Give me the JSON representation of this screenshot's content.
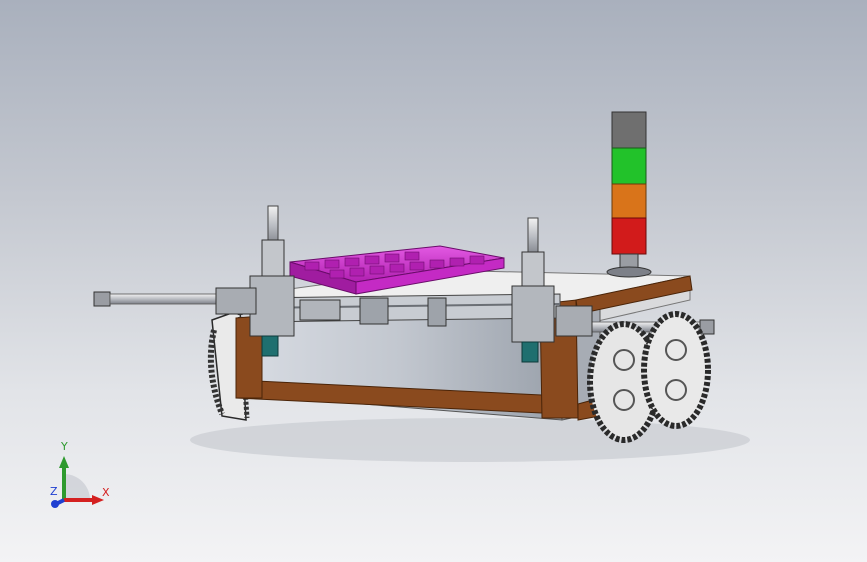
{
  "axes": {
    "x_label": "X",
    "y_label": "Y",
    "z_label": "Z"
  },
  "colors": {
    "x_axis": "#d42020",
    "y_axis": "#2e9a2e",
    "z_axis": "#1f3fd1",
    "frame": "#8a4a1e",
    "tray": "#cc33cc",
    "light_gray": "#6f6f6f",
    "light_green": "#22c22a",
    "light_orange": "#d9741a",
    "light_red": "#d21b1b"
  },
  "icons": {
    "triad": "coordinate-triad-icon"
  }
}
